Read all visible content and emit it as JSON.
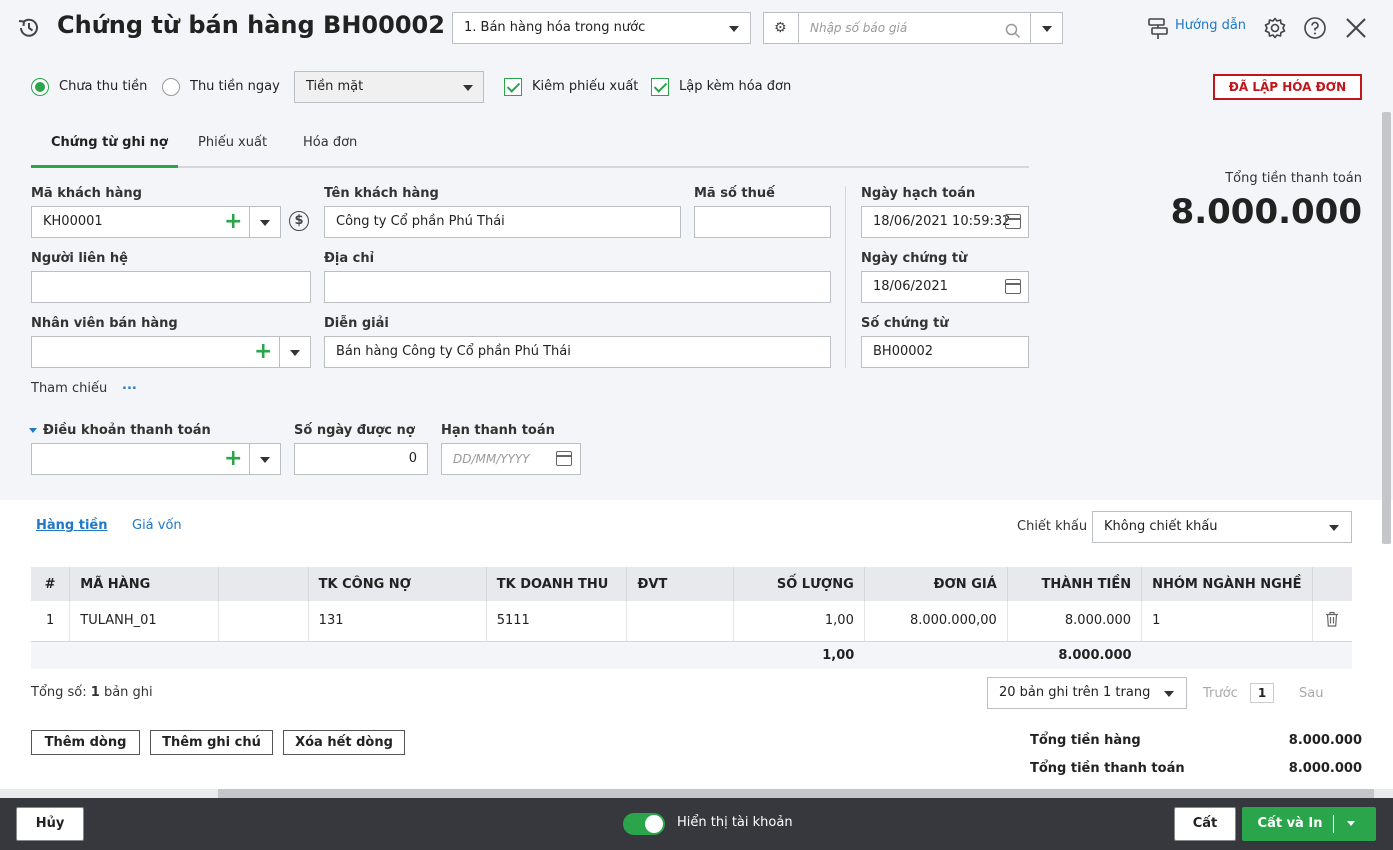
{
  "header": {
    "title": "Chứng từ bán hàng BH00002",
    "type_select": "1. Bán hàng hóa trong nước",
    "quote_placeholder": "Nhập số báo giá",
    "help_label": "Hướng dẫn"
  },
  "options": {
    "unpaid": "Chưa thu tiền",
    "paid_now": "Thu tiền ngay",
    "payment_method": "Tiền mặt",
    "with_delivery": "Kiêm phiếu xuất",
    "with_invoice": "Lập kèm hóa đơn",
    "invoice_status": "ĐÃ LẬP HÓA ĐƠN"
  },
  "tabs": [
    "Chứng từ ghi nợ",
    "Phiếu xuất",
    "Hóa đơn"
  ],
  "form": {
    "customer_code_label": "Mã khách hàng",
    "customer_code": "KH00001",
    "customer_name_label": "Tên khách hàng",
    "customer_name": "Công ty Cổ phần Phú Thái",
    "tax_code_label": "Mã số thuế",
    "tax_code": "",
    "contact_label": "Người liên hệ",
    "contact": "",
    "address_label": "Địa chỉ",
    "address": "",
    "salesperson_label": "Nhân viên bán hàng",
    "salesperson": "",
    "description_label": "Diễn giải",
    "description": "Bán hàng Công ty Cổ phần Phú Thái",
    "reference_label": "Tham chiếu",
    "reference_more": "...",
    "posting_date_label": "Ngày hạch toán",
    "posting_date": "18/06/2021 10:59:32",
    "voucher_date_label": "Ngày chứng từ",
    "voucher_date": "18/06/2021",
    "voucher_no_label": "Số chứng từ",
    "voucher_no": "BH00002",
    "payment_terms_label": "Điều khoản thanh toán",
    "payment_terms": "",
    "credit_days_label": "Số ngày được nợ",
    "credit_days": "0",
    "due_date_label": "Hạn thanh toán",
    "due_date_placeholder": "DD/MM/YYYY"
  },
  "total": {
    "label": "Tổng tiền thanh toán",
    "value": "8.000.000"
  },
  "detail": {
    "tab_goods": "Hàng tiền",
    "tab_cost": "Giá vốn",
    "discount_label": "Chiết khấu",
    "discount_value": "Không chiết khấu",
    "columns": [
      "#",
      "MÃ HÀNG",
      "",
      "TK CÔNG NỢ",
      "TK DOANH THU",
      "ĐVT",
      "SỐ LƯỢNG",
      "ĐƠN GIÁ",
      "THÀNH TIỀN",
      "NHÓM NGÀNH NGHỀ"
    ],
    "rows": [
      [
        "1",
        "TULANH_01",
        "",
        "131",
        "5111",
        "",
        "1,00",
        "8.000.000,00",
        "8.000.000",
        "1"
      ]
    ],
    "sum_qty": "1,00",
    "sum_amount": "8.000.000",
    "record_count_prefix": "Tổng số:",
    "record_count": "1",
    "record_count_suffix": "bản ghi",
    "page_size": "20 bản ghi trên 1 trang",
    "prev": "Trước",
    "page": "1",
    "next": "Sau"
  },
  "actions": {
    "add_row": "Thêm dòng",
    "add_note": "Thêm ghi chú",
    "clear_rows": "Xóa hết dòng"
  },
  "summary": {
    "goods_label": "Tổng tiền hàng",
    "goods_value": "8.000.000",
    "payment_label": "Tổng tiền thanh toán",
    "payment_value": "8.000.000"
  },
  "footer": {
    "cancel": "Hủy",
    "show_account": "Hiển thị tài khoản",
    "save": "Cất",
    "save_print": "Cất và In"
  },
  "colors": {
    "accent": "#2aa54b",
    "link": "#1f78c8",
    "invoice_red": "#c0161c",
    "footer_bg": "#36383d"
  }
}
